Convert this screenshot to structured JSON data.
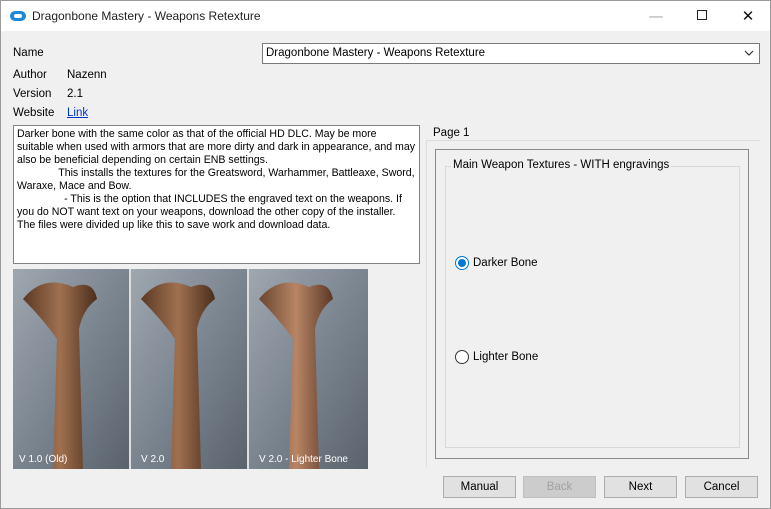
{
  "window": {
    "title": "Dragonbone Mastery - Weapons Retexture"
  },
  "info": {
    "name_label": "Name",
    "name_value": "Dragonbone Mastery - Weapons Retexture",
    "author_label": "Author",
    "author_value": "Nazenn",
    "version_label": "Version",
    "version_value": "2.1",
    "website_label": "Website",
    "website_value": "Link"
  },
  "description": "Darker bone with the same color as that of the official HD DLC. May be more suitable when used with armors that are more dirty and dark in appearance, and may also be beneficial depending on certain ENB settings.\n              This installs the textures for the Greatsword, Warhammer, Battleaxe, Sword, Waraxe, Mace and Bow.\n                - This is the option that INCLUDES the engraved text on the weapons. If you do NOT want text on your weapons, download the other copy of the installer. The files were divided up like this to save work and download data.",
  "preview": {
    "captions": [
      "V 1.0 (Old)",
      "V 2.0",
      "V 2.0 - Lighter Bone"
    ]
  },
  "page": {
    "label": "Page 1",
    "group_title": "Main Weapon Textures - WITH engravings",
    "options": [
      {
        "label": "Darker Bone",
        "selected": true
      },
      {
        "label": "Lighter Bone",
        "selected": false
      }
    ]
  },
  "buttons": {
    "manual": "Manual",
    "back": "Back",
    "next": "Next",
    "cancel": "Cancel"
  },
  "colors": {
    "accent": "#0078d7",
    "link": "#0033cc"
  }
}
